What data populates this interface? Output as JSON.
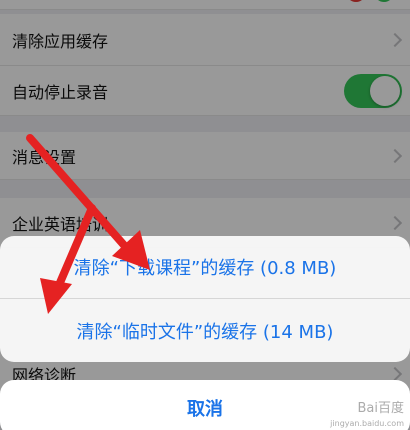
{
  "settings": {
    "rows": [
      {
        "label": "清除应用缓存",
        "type": "chevron"
      },
      {
        "label": "自动停止录音",
        "type": "toggle",
        "toggle_on": true
      },
      {
        "label": "消息设置",
        "type": "chevron"
      },
      {
        "label": "企业英语培训",
        "type": "chevron"
      },
      {
        "label": "网络诊断",
        "type": "chevron"
      }
    ]
  },
  "action_sheet": {
    "option_download_cache": "清除“下载课程”的缓存 (0.8 MB)",
    "option_temp_cache": "清除“临时文件”的缓存 (14 MB)",
    "cancel_label": "取消"
  },
  "colors": {
    "accent": "#1a73e8",
    "toggle_on": "#35c759",
    "arrow": "#e52222"
  },
  "watermark": {
    "brand": "Bai百度",
    "sub": "jingyan.baidu.com"
  }
}
